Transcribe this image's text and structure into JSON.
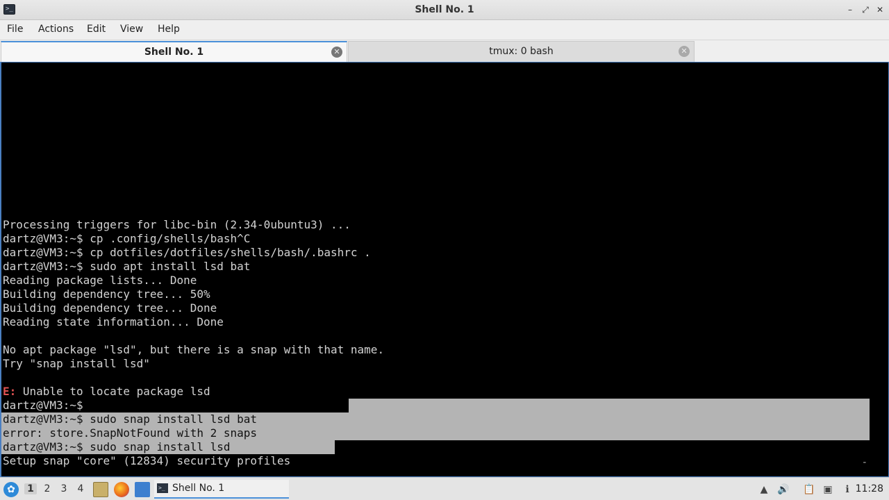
{
  "window": {
    "title": "Shell No. 1"
  },
  "menu": [
    "File",
    "Actions",
    "Edit",
    "View",
    "Help"
  ],
  "tabs": [
    {
      "label": "Shell No. 1"
    },
    {
      "label": "tmux: 0 bash"
    }
  ],
  "terminal": {
    "lines": [
      "Processing triggers for libc-bin (2.34-0ubuntu3) ...",
      "dartz@VM3:~$ cp .config/shells/bash^C",
      "dartz@VM3:~$ cp dotfiles/dotfiles/shells/bash/.bashrc .",
      "dartz@VM3:~$ sudo apt install lsd bat",
      "Reading package lists... Done",
      "Building dependency tree... 50%",
      "Building dependency tree... Done",
      "Reading state information... Done",
      "",
      "No apt package \"lsd\", but there is a snap with that name.",
      "Try \"snap install lsd\"",
      "",
      {
        "prefix": "E:",
        "text": " Unable to locate package lsd"
      },
      "dartz@VM3:~$",
      "dartz@VM3:~$ sudo snap install lsd bat",
      "error: store.SnapNotFound with 2 snaps",
      "dartz@VM3:~$ sudo snap install lsd",
      "Setup snap \"core\" (12834) security profiles"
    ],
    "status_dash": "-"
  },
  "taskbar": {
    "workspaces": [
      "1",
      "2",
      "3",
      "4"
    ],
    "active_workspace": "1",
    "task_label": "Shell No. 1",
    "clock": "11:28"
  }
}
